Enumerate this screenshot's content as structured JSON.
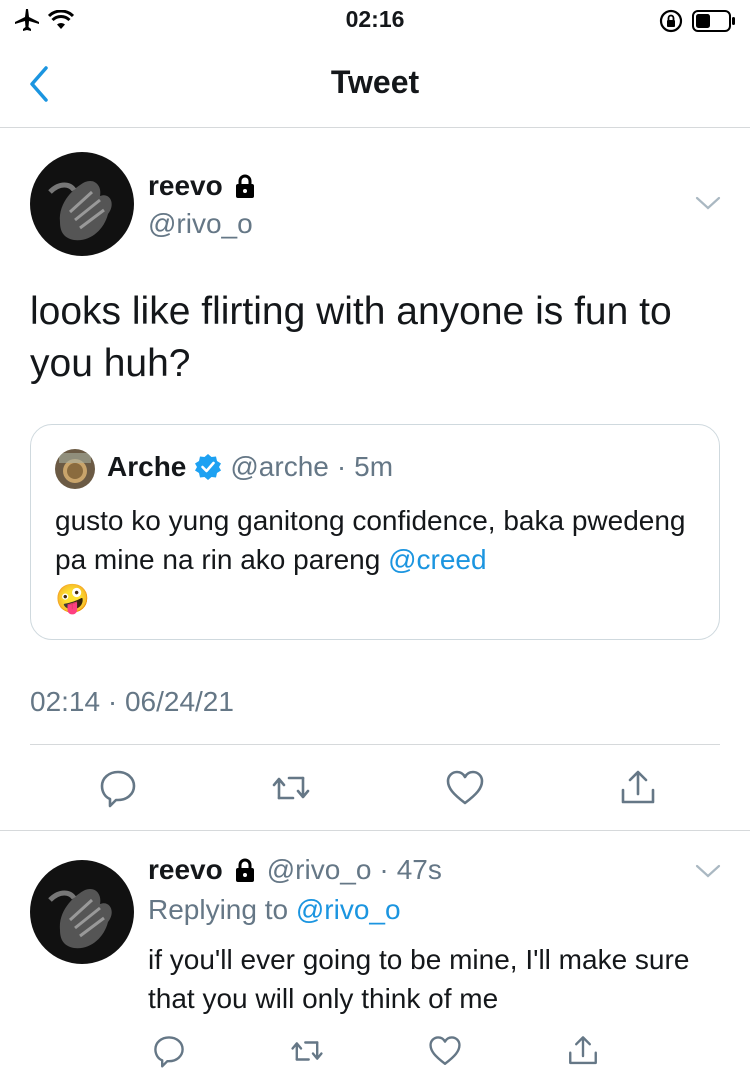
{
  "status_bar": {
    "time": "02:16",
    "icons": [
      "airplane-icon",
      "wifi-icon",
      "rotation-lock-icon",
      "battery-icon"
    ]
  },
  "nav": {
    "title": "Tweet",
    "back_icon": "chevron-left-icon"
  },
  "tweet": {
    "author_name": "reevo",
    "author_handle": "@rivo_o",
    "protected_icon": "lock-icon",
    "text": "looks like flirting with anyone is fun to you huh?",
    "timestamp": "02:14 · 06/24/21",
    "quote": {
      "author_name": "Arche",
      "verified_icon": "verified-badge-icon",
      "handle": "@arche",
      "dot": "·",
      "age": "5m",
      "text": "gusto ko yung ganitong confidence, baka pwedeng pa mine na rin ako pareng ",
      "mention": "@creed",
      "emoji": "🤪"
    }
  },
  "reply": {
    "author_name": "reevo",
    "author_handle": "@rivo_o",
    "dot": "·",
    "age": "47s",
    "replying_to_label": "Replying to ",
    "replying_to_handle": "@rivo_o",
    "text": "if you'll ever going to be mine, I'll make sure that you will only think of me"
  },
  "actions": [
    "reply-icon",
    "retweet-icon",
    "like-icon",
    "share-icon"
  ],
  "colors": {
    "accent": "#1b95e0",
    "text": "#14171a",
    "secondary": "#657786",
    "divider": "#d6d9db",
    "verified": "#1da1f2"
  }
}
